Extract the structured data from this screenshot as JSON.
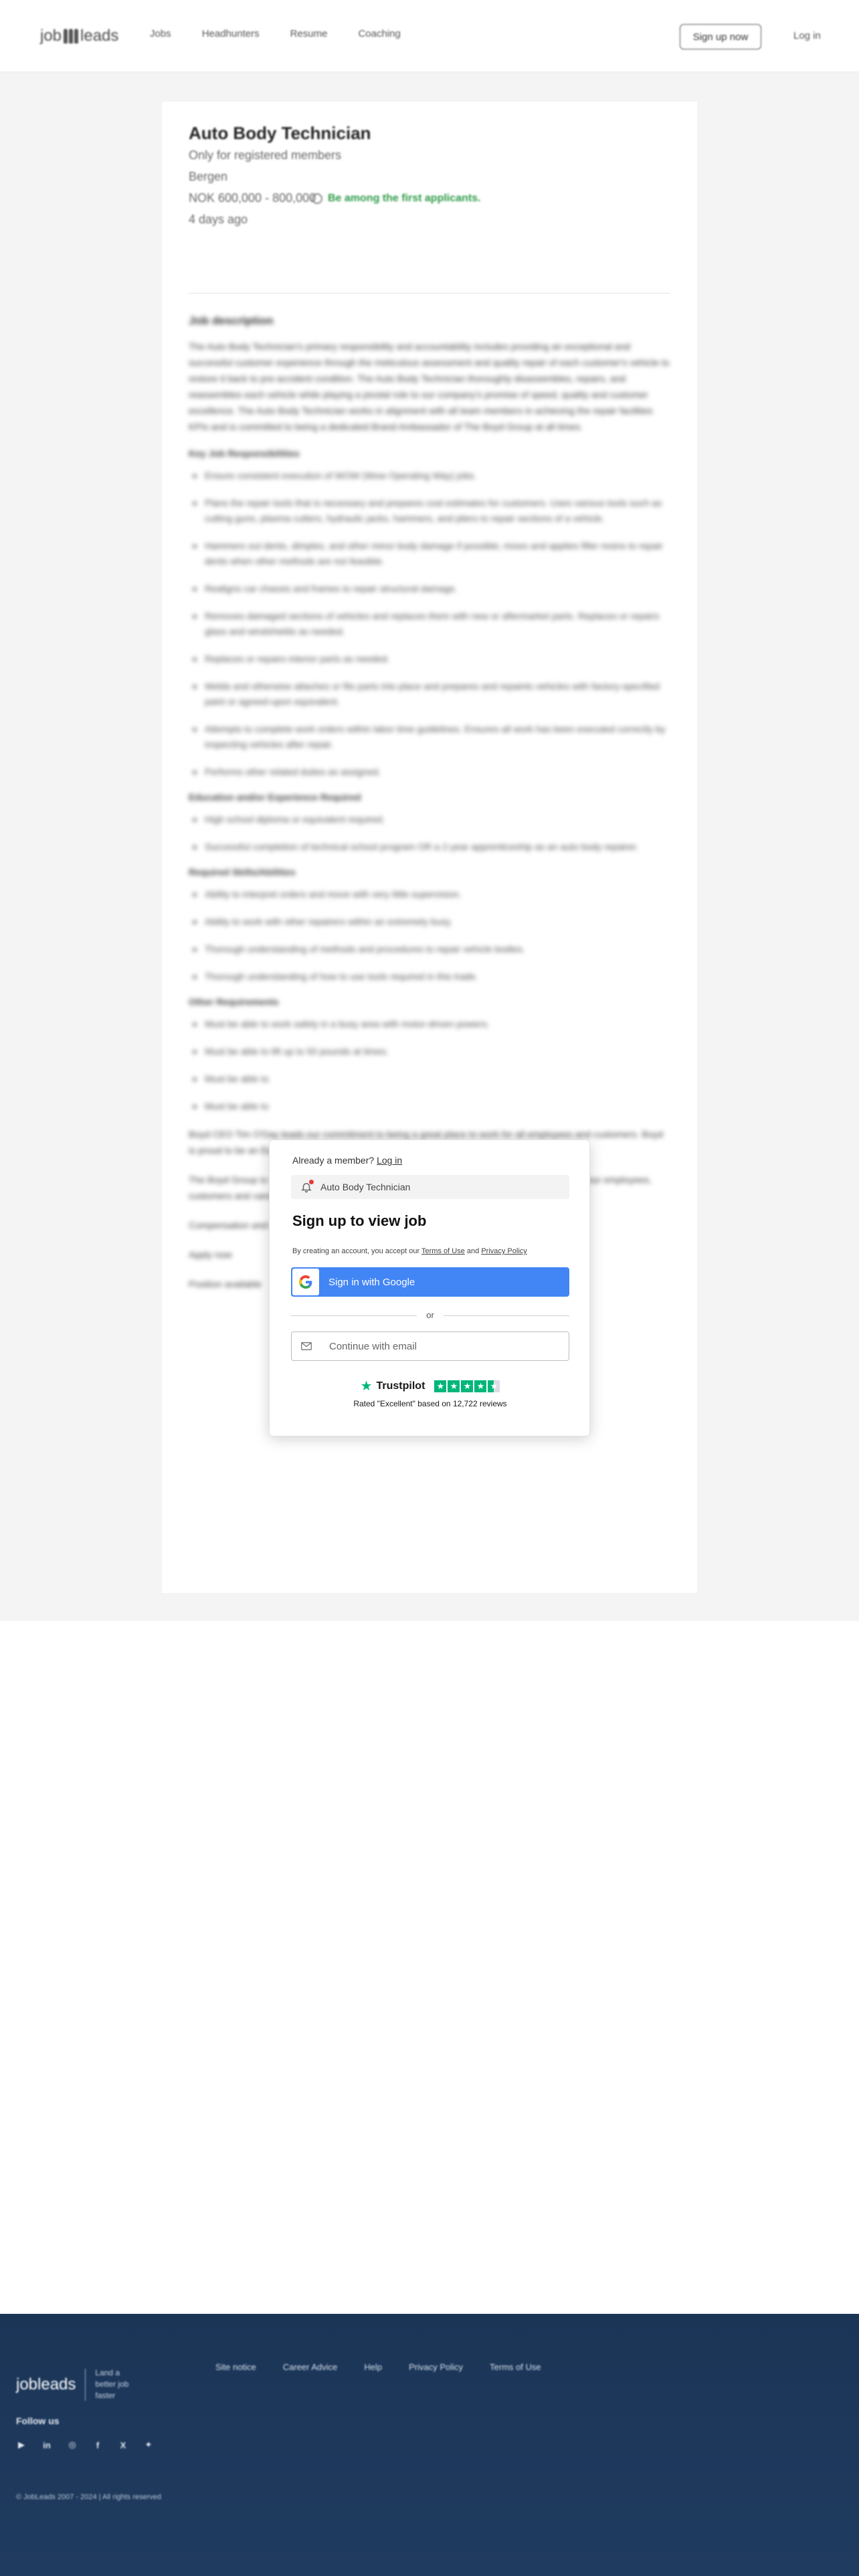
{
  "header": {
    "logo_text": "jobleads",
    "nav": [
      "Jobs",
      "Headhunters",
      "Resume",
      "Coaching"
    ],
    "signup_label": "Sign up now",
    "login_label": "Log in"
  },
  "job": {
    "title": "Auto Body Technician",
    "visibility": "Only for registered members",
    "location": "Bergen",
    "salary": "NOK 600,000 - 800,000",
    "applicants_note": "Be among the first applicants.",
    "posted": "4 days ago",
    "description_heading": "Job description",
    "summary": "The Auto Body Technician's primary responsibility and accountability includes providing an exceptional and successful customer experience through the meticulous assessment and quality repair of each customer's vehicle to restore it back to pre-accident condition. The Auto Body Technician thoroughly disassembles, repairs, and reassembles each vehicle while playing a pivotal role to our company's promise of speed, quality and customer excellence. The Auto Body Technician works in alignment with all team members in achieving the repair facilities KPIs and is committed to being a dedicated Brand Ambassador of The Boyd Group at all times.",
    "sections": [
      {
        "heading": "Key Job Responsibilities",
        "items": [
          "Ensure consistent execution of WOW (Wow Operating Way) jobs.",
          "Plans the repair tools that is necessary and prepares cost estimates for customers. Uses various tools such as cutting guns, plasma cutters, hydraulic jacks, hammers, and pliers to repair sections of a vehicle.",
          "Hammers out dents, dimples, and other minor body damage if possible; mixes and applies filler resins to repair dents when other methods are not feasible.",
          "Realigns car chassis and frames to repair structural damage.",
          "Removes damaged sections of vehicles and replaces them with new or aftermarket parts. Replaces or repairs glass and windshields as needed.",
          "Replaces or repairs interior parts as needed.",
          "Welds and otherwise attaches or fits parts into place and prepares and repaints vehicles with factory-specified paint or agreed-upon equivalent.",
          "Attempts to complete work orders within labor time guidelines. Ensures all work has been executed correctly by inspecting vehicles after repair.",
          "Performs other related duties as assigned."
        ]
      },
      {
        "heading": "Education and/or Experience Required",
        "items": [
          "High school diploma or equivalent required.",
          "Successful completion of technical school program OR a 2-year apprenticeship as an auto body repairer."
        ]
      },
      {
        "heading": "Required Skills/Abilities",
        "items": [
          "Ability to interpret orders and move with very little supervision.",
          "Ability to work with other repairers within an extremely busy.",
          "Thorough understanding of methods and procedures to repair vehicle bodies.",
          "Thorough understanding of how to use tools required in this trade."
        ]
      },
      {
        "heading": "Other Requirements",
        "items": [
          "Must be able to work safely in a busy area with motor-driven powers.",
          "Must be able to lift up to 50 pounds at times.",
          "Must be able to",
          "Must be able to"
        ]
      }
    ],
    "closing": [
      "Boyd CEO Tim O'Day leads our commitment to being a great place to work for all employees and customers. Boyd is proud to be an Equal Opportunity Employer and values diversity.",
      "The Boyd Group is committed to providing a safe, respectful, and welcoming environment for all our employees, customers and candidates. Please contact us with any questions.",
      "Compensation and benefits",
      "Apply now",
      "Position available"
    ]
  },
  "modal": {
    "already_member": "Already a member?",
    "login_link": "Log in",
    "job_chip": "Auto Body Technician",
    "title": "Sign up to view job",
    "terms_prefix": "By creating an account, you accept our",
    "terms_link": "Terms of Use",
    "terms_and": "and",
    "privacy_link": "Privacy Policy",
    "google_label": "Sign in with Google",
    "or_label": "or",
    "email_label": "Continue with email",
    "trustpilot_name": "Trustpilot",
    "trustpilot_rating_text": "Rated \"Excellent\" based on 12,722 reviews",
    "trustpilot_stars": 4.5
  },
  "footer": {
    "logo_text": "jobleads",
    "tagline": "Land a better job faster",
    "links": [
      "Site notice",
      "Career Advice",
      "Help",
      "Privacy Policy",
      "Terms of Use"
    ],
    "follow_label": "Follow us",
    "socials": [
      "youtube-icon",
      "linkedin-icon",
      "instagram-icon",
      "facebook-icon",
      "x-icon",
      "bluesky-icon"
    ],
    "copyright": "© JobLeads 2007 - 2024 | All rights reserved"
  },
  "colors": {
    "accent_green": "#2e9b48",
    "google_blue": "#4285f4",
    "trustpilot_green": "#00b67a",
    "footer_navy": "#1b3557"
  }
}
